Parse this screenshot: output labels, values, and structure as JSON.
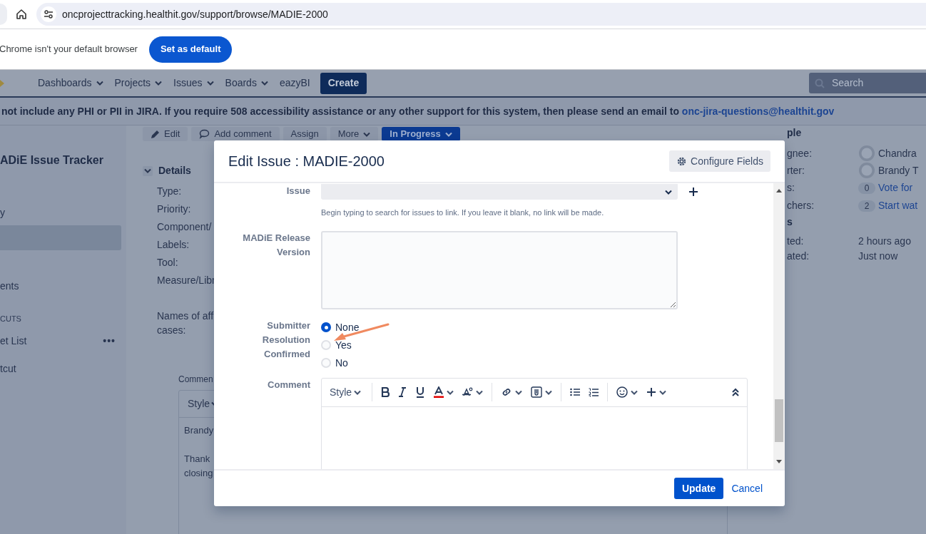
{
  "browser": {
    "url": "oncprojecttracking.healthit.gov/support/browse/MADIE-2000",
    "infobar": {
      "message": "Chrome isn't your default browser",
      "button": "Set as default"
    }
  },
  "nav": {
    "items": [
      {
        "label": "Dashboards",
        "dropdown": true
      },
      {
        "label": "Projects",
        "dropdown": true
      },
      {
        "label": "Issues",
        "dropdown": true
      },
      {
        "label": "Boards",
        "dropdown": true
      },
      {
        "label": "eazyBI",
        "dropdown": false
      }
    ],
    "create": "Create",
    "search": {
      "placeholder": "Search"
    }
  },
  "banner": {
    "text": "not include any PHI or PII in JIRA. If you require 508 accessibility assistance or any other support for this system, then please send an email to",
    "link": "onc-jira-questions@healthit.gov"
  },
  "sidebar": {
    "title": "ADiE Issue Tracker",
    "items": [
      {
        "label": "y",
        "selected": false
      },
      {
        "selected": true
      },
      {
        "label": "ents",
        "selected": false
      }
    ],
    "section": "CUTS",
    "shortcuts": [
      {
        "label": "et List",
        "more": "•••"
      },
      {
        "label": "tcut"
      }
    ]
  },
  "issue": {
    "actions": [
      {
        "kind": "edit",
        "label": "Edit"
      },
      {
        "kind": "comment",
        "label": "Add comment"
      },
      {
        "kind": "plain",
        "label": "Assign"
      },
      {
        "kind": "dropdown",
        "label": "More"
      },
      {
        "kind": "status",
        "label": "In Progress"
      }
    ],
    "details": {
      "title": "Details",
      "expanded": true,
      "labels": [
        "Type:",
        "Priority:",
        "Component/",
        "Labels:",
        "Tool:",
        "Measure/Libr",
        "Names of aff cases:"
      ]
    },
    "comment": {
      "label": "Commen",
      "style": "Style",
      "lines": [
        "Brandy",
        "Thank",
        "closing"
      ]
    },
    "people": {
      "title": "ple",
      "rows": [
        {
          "kind": "user",
          "label": "gnee:",
          "value": "Chandra"
        },
        {
          "kind": "user",
          "label": "rter:",
          "value": "Brandy T"
        },
        {
          "kind": "count",
          "label": "s:",
          "count": "0",
          "value": "Vote for"
        },
        {
          "kind": "count",
          "label": "chers:",
          "count": "2",
          "value": "Start wat"
        }
      ]
    },
    "dates": {
      "title": "s",
      "rows": [
        {
          "label": "ted:",
          "value": "2 hours ago"
        },
        {
          "label": "ated:",
          "value": "Just now"
        }
      ]
    }
  },
  "dialog": {
    "title": "Edit Issue : MADIE-2000",
    "configure": "Configure Fields",
    "fields": [
      {
        "kind": "select",
        "label": "Issue",
        "help": "Begin typing to search for issues to link. If you leave it blank, no link will be made."
      },
      {
        "kind": "textarea",
        "label": "MADiE Release Version"
      },
      {
        "kind": "radio",
        "label": "Submitter Resolution Confirmed",
        "options": [
          {
            "label": "None",
            "selected": true
          },
          {
            "label": "Yes",
            "selected": false
          },
          {
            "label": "No",
            "selected": false
          }
        ]
      },
      {
        "kind": "editor",
        "label": "Comment",
        "style": "Style"
      }
    ],
    "update": "Update",
    "cancel": "Cancel"
  }
}
